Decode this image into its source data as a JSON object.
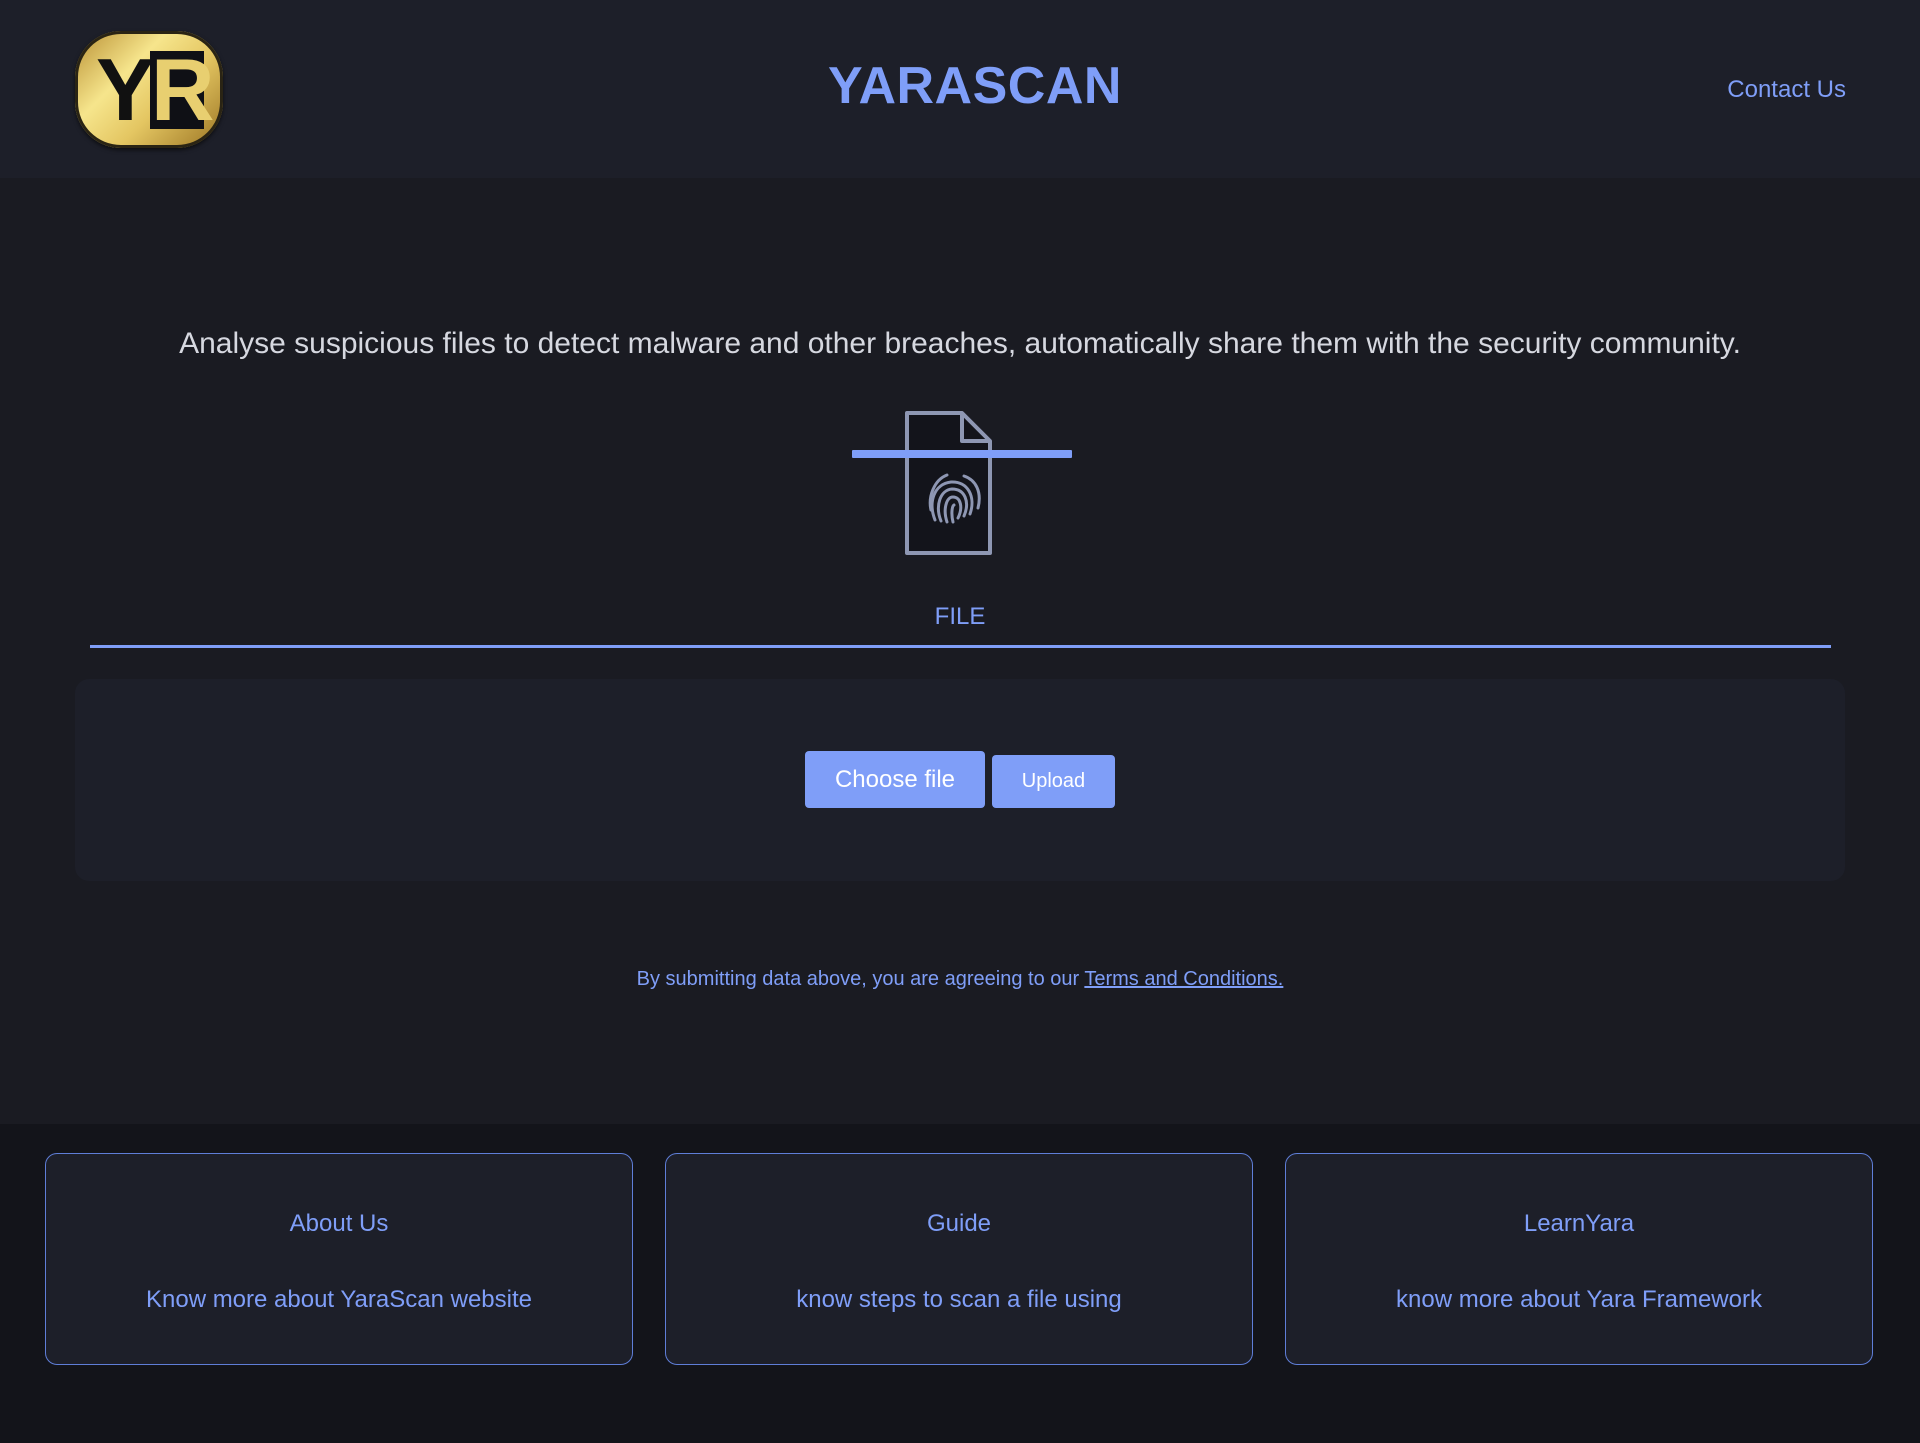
{
  "header": {
    "logo_text": "YR",
    "site_title": "YARASCAN",
    "contact_link": "Contact Us"
  },
  "main": {
    "tagline": "Analyse suspicious files to detect malware and other breaches, automatically share them with the security community.",
    "tab_label": "FILE",
    "choose_file_label": "Choose file",
    "upload_label": "Upload",
    "terms_prefix": "By submitting data above, you are agreeing to our ",
    "terms_link": "Terms and Conditions."
  },
  "footer": {
    "cards": [
      {
        "title": "About Us",
        "description": "Know more about YaraScan website"
      },
      {
        "title": "Guide",
        "description": "know steps to scan a file using"
      },
      {
        "title": "LearnYara",
        "description": "know more about Yara Framework"
      }
    ]
  },
  "colors": {
    "accent": "#7f9ef8",
    "background": "#1a1b22",
    "header_background": "#1d1f29",
    "footer_background": "#13141a"
  },
  "icons": {
    "file_icon": "fingerprint-file-icon"
  }
}
